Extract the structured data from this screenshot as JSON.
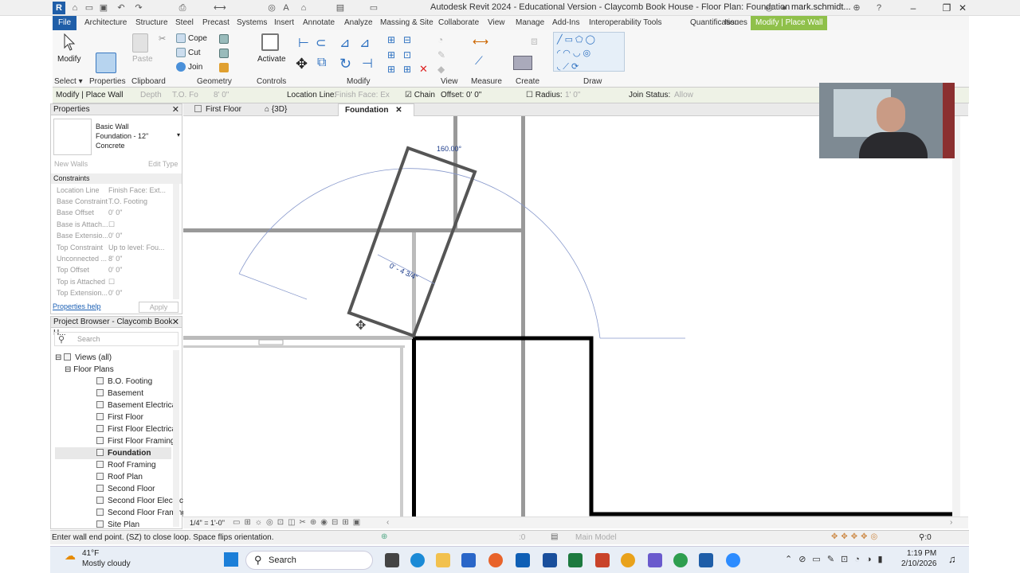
{
  "window": {
    "title": "Autodesk Revit 2024 - Educational Version - Claycomb Book House - Floor Plan: Foundation",
    "user": "mark.schmidt...",
    "app_logo": "R"
  },
  "ribbon_tabs": [
    "File",
    "Architecture",
    "Structure",
    "Steel",
    "Precast",
    "Systems",
    "Insert",
    "Annotate",
    "Analyze",
    "Massing & Site",
    "Collaborate",
    "View",
    "Manage",
    "Add-Ins",
    "Interoperability Tools",
    "Quantification",
    "Issues",
    "Modify | Place Wall"
  ],
  "ribbon": {
    "modify_label": "Modify",
    "panels": [
      "Select",
      "Properties",
      "Clipboard",
      "Geometry",
      "Controls",
      "Modify",
      "View",
      "Measure",
      "Create",
      "Draw"
    ],
    "properties_label": "Properties",
    "paste_label": "Paste",
    "cope_label": "Cope",
    "cut_label": "Cut",
    "join_label": "Join",
    "activate_label": "Activate"
  },
  "options_bar": {
    "context": "Modify | Place Wall",
    "depth_label": "Depth",
    "depth_value": "T.O. Fo",
    "height_value": "8' 0\"",
    "location_line_label": "Location Line:",
    "location_line_value": "Finish Face: Ex",
    "chain_label": "Chain",
    "chain_checked": true,
    "offset_label": "Offset:",
    "offset_value": "0' 0\"",
    "radius_label": "Radius:",
    "radius_value": "1' 0\"",
    "join_status_label": "Join Status:",
    "join_status_value": "Allow"
  },
  "properties": {
    "title": "Properties",
    "type_family": "Basic Wall",
    "type_name": "Foundation - 12\"",
    "type_material": "Concrete",
    "new_walls": "New Walls",
    "edit_type": "Edit Type",
    "section": "Constraints",
    "rows": [
      {
        "k": "Location Line",
        "v": "Finish Face: Ext..."
      },
      {
        "k": "Base Constraint",
        "v": "T.O. Footing"
      },
      {
        "k": "Base Offset",
        "v": "0' 0\""
      },
      {
        "k": "Base is Attach...",
        "v": ""
      },
      {
        "k": "Base Extensio...",
        "v": "0' 0\""
      },
      {
        "k": "Top Constraint",
        "v": "Up to level: Fou..."
      },
      {
        "k": "Unconnected ...",
        "v": "8' 0\""
      },
      {
        "k": "Top Offset",
        "v": "0' 0\""
      },
      {
        "k": "Top is Attached",
        "v": ""
      },
      {
        "k": "Top Extension...",
        "v": "0' 0\""
      }
    ],
    "help_link": "Properties help",
    "apply_label": "Apply"
  },
  "project_browser": {
    "title": "Project Browser - Claycomb Book H...",
    "search_placeholder": "Search",
    "views_all": "Views (all)",
    "floor_plans": "Floor Plans",
    "items": [
      "B.O. Footing",
      "Basement",
      "Basement Electrical",
      "First Floor",
      "First Floor Electrical",
      "First Floor Framing",
      "Foundation",
      "Roof Framing",
      "Roof Plan",
      "Second Floor",
      "Second Floor Electrical",
      "Second Floor Framing",
      "Site Plan"
    ],
    "active_index": 6
  },
  "view_tabs": [
    {
      "label": "First Floor",
      "active": false
    },
    {
      "label": "{3D}",
      "active": false
    },
    {
      "label": "Foundation",
      "active": true
    }
  ],
  "canvas": {
    "angle_label": "160.00°",
    "dim_label": "0' - 4 3/4\""
  },
  "view_control": {
    "scale": "1/4\" = 1'-0\""
  },
  "status": {
    "message": "Enter wall end point. (SZ) to close loop. Space flips orientation.",
    "model": "Main Model",
    "count_a": ":0",
    "filter_count": ":0"
  },
  "taskbar": {
    "weather_temp": "41°F",
    "weather_desc": "Mostly cloudy",
    "search_label": "Search",
    "time": "1:19 PM",
    "date": "2/10/2026"
  }
}
